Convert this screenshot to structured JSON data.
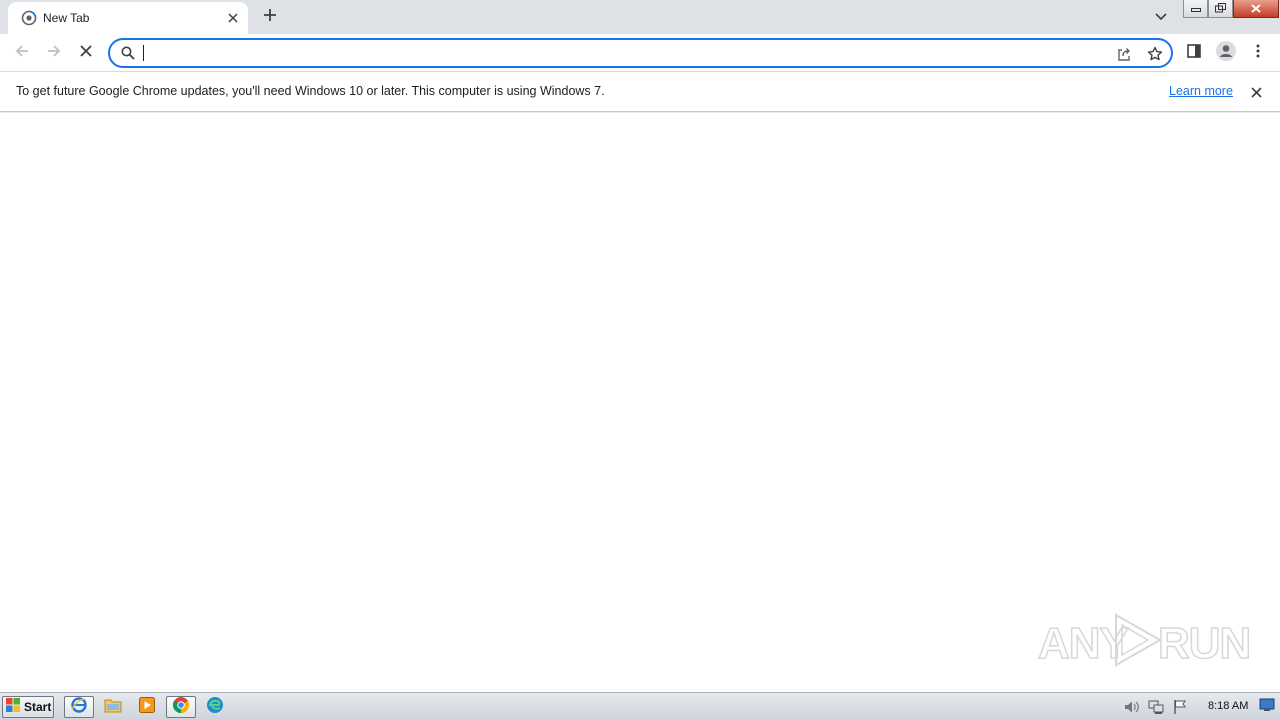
{
  "browser": {
    "tab": {
      "title": "New Tab"
    },
    "omnibox": {
      "value": "",
      "placeholder": ""
    }
  },
  "infobar": {
    "message": "To get future Google Chrome updates, you'll need Windows 10 or later. This computer is using Windows 7.",
    "link_label": "Learn more"
  },
  "watermark": {
    "text": "ANY RUN"
  },
  "taskbar": {
    "start_label": "Start",
    "clock": "8:18 AM"
  },
  "icons": {
    "tab_favicon": "chrome-loading-icon",
    "tab_close": "close-icon",
    "new_tab": "plus-icon",
    "tab_search": "chevron-down-icon",
    "back": "arrow-left-icon",
    "forward": "arrow-right-icon",
    "stop": "close-icon",
    "search": "search-icon",
    "share": "share-icon",
    "bookmark": "star-icon",
    "side_panel": "side-panel-icon",
    "profile": "avatar-icon",
    "menu": "kebab-menu-icon"
  },
  "colors": {
    "accent": "#1a73e8",
    "tabstrip": "#dee1e6",
    "taskbar": "#d8dde3"
  }
}
